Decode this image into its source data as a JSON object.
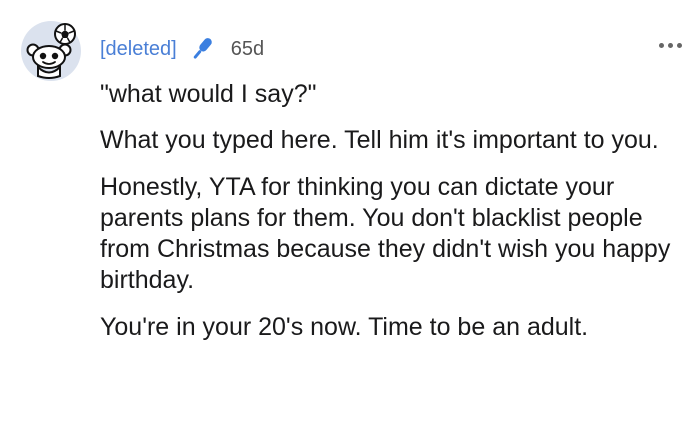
{
  "comment": {
    "avatar": "reddit-snoo-avatar-with-soccer-ball",
    "author": "[deleted]",
    "badge_icon": "microphone-icon",
    "age": "65d",
    "more_icon": "more-options-icon",
    "paragraphs": [
      "\"what would I say?\"",
      "What you typed here. Tell him it's important to you.",
      "Honestly, YTA for thinking you can dictate your parents plans for them. You don't blacklist people from Christmas because they didn't wish you happy birthday.",
      "You're in your 20's now. Time to be an adult."
    ]
  },
  "colors": {
    "author_link": "#4a7fd6",
    "mic_icon": "#3b7fe0",
    "text": "#1a1a1b",
    "meta": "#555555"
  }
}
